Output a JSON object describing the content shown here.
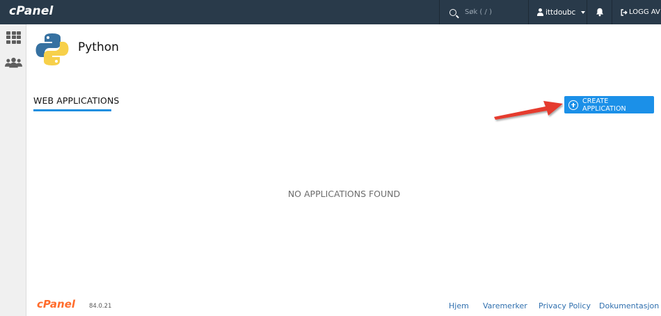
{
  "header": {
    "brand": "cPanel",
    "search_placeholder": "Søk ( / )",
    "username": "ittdoubc",
    "logout_label": "LOGG AV"
  },
  "page": {
    "title": "Python",
    "tab_label": "WEB APPLICATIONS",
    "create_button_label": "CREATE APPLICATION",
    "empty_message": "NO APPLICATIONS FOUND"
  },
  "footer": {
    "brand": "cPanel",
    "version": "84.0.21",
    "links": [
      "Hjem",
      "Varemerker",
      "Privacy Policy",
      "Dokumentasjon"
    ]
  },
  "colors": {
    "topbar": "#293a4a",
    "accent": "#1b90e8",
    "footer_brand": "#ff6c2c",
    "annotation_arrow": "#e53b2f"
  },
  "icons": {
    "sidebar": [
      "apps-grid-icon",
      "users-icon"
    ],
    "header": [
      "search-icon",
      "user-icon",
      "bell-icon",
      "logout-icon"
    ],
    "app": "python-logo"
  }
}
